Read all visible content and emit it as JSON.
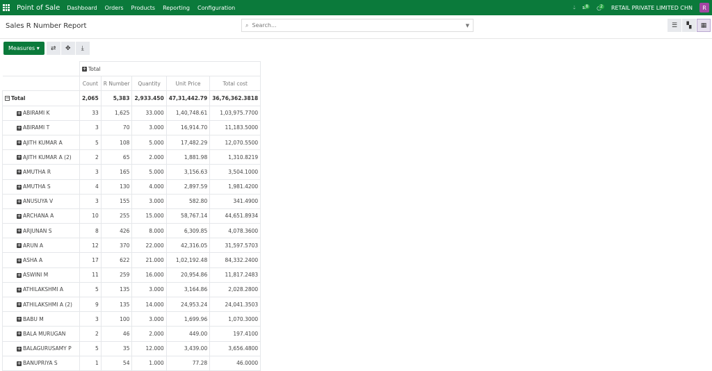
{
  "nav": {
    "brand": "Point of Sale",
    "menus": [
      "Dashboard",
      "Orders",
      "Products",
      "Reporting",
      "Configuration"
    ],
    "messages_count": "8",
    "activities_count": "2",
    "company": "RETAIL PRIVATE LIMITED CHN",
    "avatar": "R"
  },
  "header": {
    "title": "Sales R Number Report",
    "search_placeholder": "Search..."
  },
  "toolbar": {
    "measures_label": "Measures"
  },
  "pivot": {
    "col_group": "Total",
    "measures": [
      "Count",
      "R Number",
      "Quantity",
      "Unit Price",
      "Total cost"
    ],
    "total": {
      "label": "Total",
      "values": [
        "2,065",
        "5,383",
        "2,933.450",
        "47,31,442.79",
        "36,76,362.3818"
      ]
    },
    "rows": [
      {
        "label": "ABIRAMI K",
        "values": [
          "33",
          "1,625",
          "33.000",
          "1,40,748.61",
          "1,03,975.7700"
        ]
      },
      {
        "label": "ABIRAMI T",
        "values": [
          "3",
          "70",
          "3.000",
          "16,914.70",
          "11,183.5000"
        ]
      },
      {
        "label": "AJITH KUMAR A",
        "values": [
          "5",
          "108",
          "5.000",
          "17,482.29",
          "12,070.5500"
        ]
      },
      {
        "label": "AJITH KUMAR A (2)",
        "values": [
          "2",
          "65",
          "2.000",
          "1,881.98",
          "1,310.8219"
        ]
      },
      {
        "label": "AMUTHA R",
        "values": [
          "3",
          "165",
          "5.000",
          "3,156.63",
          "3,504.1000"
        ]
      },
      {
        "label": "AMUTHA S",
        "values": [
          "4",
          "130",
          "4.000",
          "2,897.59",
          "1,981.4200"
        ]
      },
      {
        "label": "ANUSUYA V",
        "values": [
          "3",
          "155",
          "3.000",
          "582.80",
          "341.4900"
        ]
      },
      {
        "label": "ARCHANA A",
        "values": [
          "10",
          "255",
          "15.000",
          "58,767.14",
          "44,651.8934"
        ]
      },
      {
        "label": "ARJUNAN S",
        "values": [
          "8",
          "426",
          "8.000",
          "6,309.85",
          "4,078.3600"
        ]
      },
      {
        "label": "ARUN A",
        "values": [
          "12",
          "370",
          "22.000",
          "42,316.05",
          "31,597.5703"
        ]
      },
      {
        "label": "ASHA A",
        "values": [
          "17",
          "622",
          "21.000",
          "1,02,192.48",
          "84,332.2400"
        ]
      },
      {
        "label": "ASWINI M",
        "values": [
          "11",
          "259",
          "16.000",
          "20,954.86",
          "11,817.2483"
        ]
      },
      {
        "label": "ATHILAKSHMI A",
        "values": [
          "5",
          "135",
          "3.000",
          "3,164.86",
          "2,028.2800"
        ]
      },
      {
        "label": "ATHILAKSHMI A (2)",
        "values": [
          "9",
          "135",
          "14.000",
          "24,953.24",
          "24,041.3503"
        ]
      },
      {
        "label": "BABU M",
        "values": [
          "3",
          "100",
          "3.000",
          "1,699.96",
          "1,070.3000"
        ]
      },
      {
        "label": "BALA MURUGAN",
        "values": [
          "2",
          "46",
          "2.000",
          "449.00",
          "197.4100"
        ]
      },
      {
        "label": "BALAGURUSAMY P",
        "values": [
          "5",
          "35",
          "12.000",
          "3,439.00",
          "3,656.4800"
        ]
      },
      {
        "label": "BANUPRIYA S",
        "values": [
          "1",
          "54",
          "1.000",
          "77.28",
          "46.0000"
        ]
      }
    ]
  }
}
